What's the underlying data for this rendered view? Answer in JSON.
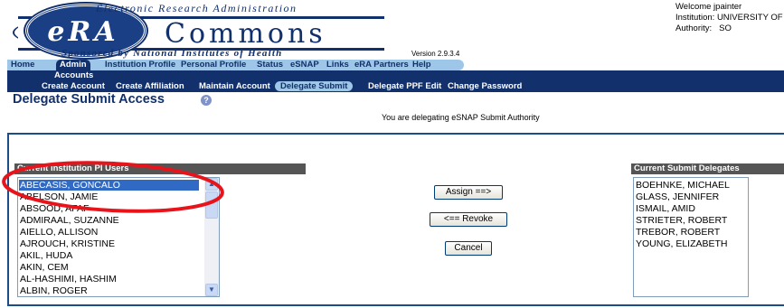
{
  "header": {
    "logo_top": "Electronic Research Administration",
    "logo_era": "eRA",
    "logo_commons": "Commons",
    "logo_bottom": "Sponsored by National Institutes of Health",
    "version": "Version 2.9.3.4",
    "welcome": "Welcome  jpainter",
    "institution": "Institution: UNIVERSITY OF",
    "authority_label": "Authority:",
    "authority_value": "SO"
  },
  "main_nav": [
    "Home",
    "Admin",
    "Institution Profile",
    "Personal Profile",
    "Status",
    "eSNAP",
    "Links",
    "eRA Partners",
    "Help"
  ],
  "main_nav_selected": "Admin",
  "sub_nav": {
    "section": "Accounts",
    "items": [
      "Create Account",
      "Create Affiliation",
      "Maintain Account",
      "Delegate Submit",
      "Delegate PPF Edit",
      "Change Password"
    ],
    "selected": "Delegate Submit"
  },
  "page": {
    "title": "Delegate Submit Access",
    "help_icon": "question-circle-icon",
    "message": "You are delegating eSNAP Submit Authority"
  },
  "left_list": {
    "header": "Current Institution PI Users",
    "selected": "ABECASIS, GONCALO",
    "items": [
      "ABECASIS, GONCALO",
      "ABELSON, JAMIE",
      "ABSOOD, AFAF",
      "ADMIRAAL, SUZANNE",
      "AIELLO, ALLISON",
      "AJROUCH, KRISTINE",
      "AKIL, HUDA",
      "AKIN, CEM",
      "AL-HASHIMI, HASHIM",
      "ALBIN, ROGER"
    ]
  },
  "right_list": {
    "header": "Current Submit Delegates",
    "items": [
      "BOEHNKE, MICHAEL",
      "GLASS, JENNIFER",
      "ISMAIL, AMID",
      "STRIETER, ROBERT",
      "TREBOR, ROBERT",
      "YOUNG, ELIZABETH"
    ]
  },
  "buttons": {
    "assign": "Assign ==>",
    "revoke": "<== Revoke",
    "cancel": "Cancel"
  },
  "colors": {
    "navy": "#12306b",
    "light_blue": "#9ec6e8",
    "selection": "#316ac5",
    "annotation": "#e8141b"
  }
}
